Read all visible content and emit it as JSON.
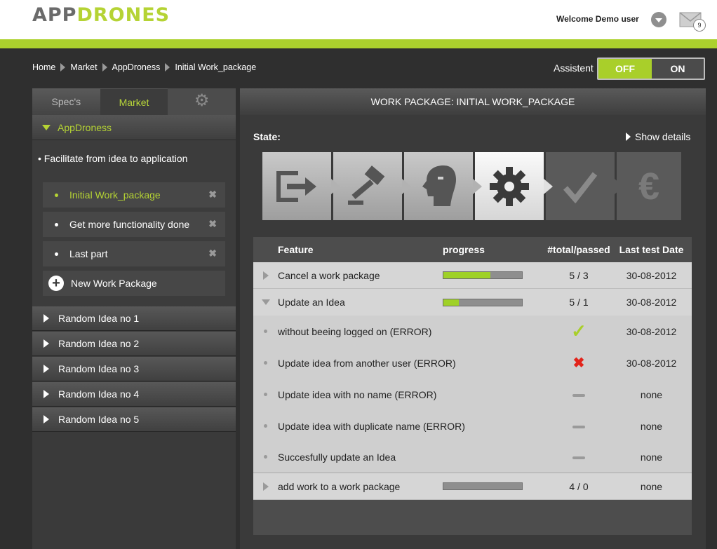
{
  "header": {
    "logo_a": "APP",
    "logo_b": "DRONES",
    "welcome": "Welcome Demo user",
    "mail_count": "9"
  },
  "breadcrumb": [
    "Home",
    "Market",
    "AppDroness",
    "Initial Work_package"
  ],
  "assistant": {
    "label": "Assistent",
    "off": "OFF",
    "on": "ON",
    "selected": "OFF"
  },
  "sidebar": {
    "tabs": [
      "Spec's",
      "Market"
    ],
    "active_tab": "Market",
    "section": "AppDroness",
    "description": "Facilitate from idea to application",
    "work_packages": [
      "Initial Work_package",
      "Get more functionality done",
      "Last part"
    ],
    "active_package": "Initial Work_package",
    "new_package": "New Work Package",
    "ideas": [
      "Random Idea no 1",
      "Random Idea no 2",
      "Random Idea no 3",
      "Random Idea no 4",
      "Random Idea no 5"
    ]
  },
  "main": {
    "title": "WORK PACKAGE: INITIAL WORK_PACKAGE",
    "state_label": "State:",
    "show_details": "Show details",
    "states": [
      "sign-in-icon",
      "gavel-icon",
      "head-icon",
      "gear-icon",
      "checkmark-icon",
      "euro-icon"
    ],
    "active_state": "gear-icon",
    "table": {
      "headers": [
        "Feature",
        "progress",
        "#total/passed",
        "Last test Date"
      ],
      "rows": [
        {
          "feature": "Cancel a work package",
          "progress": 0.6,
          "total": "5 / 3",
          "date": "30-08-2012"
        },
        {
          "feature": "Update an Idea",
          "progress": 0.2,
          "total": "5 / 1",
          "date": "30-08-2012",
          "subs": [
            {
              "feature": "without beeing logged on (ERROR)",
              "status": "passed",
              "date": "30-08-2012"
            },
            {
              "feature": "Update idea from another user (ERROR)",
              "status": "failed",
              "date": "30-08-2012"
            },
            {
              "feature": "Update idea with no name (ERROR)",
              "status": "none",
              "date": "none"
            },
            {
              "feature": "Update idea with duplicate name (ERROR)",
              "status": "none",
              "date": "none"
            },
            {
              "feature": "Succesfully update an Idea",
              "status": "none",
              "date": "none"
            }
          ]
        },
        {
          "feature": "add work to a work package",
          "progress": 0,
          "total": "4 / 0",
          "date": "none"
        }
      ]
    }
  },
  "colors": {
    "accent": "#acd12d",
    "fail": "#e2231a"
  }
}
